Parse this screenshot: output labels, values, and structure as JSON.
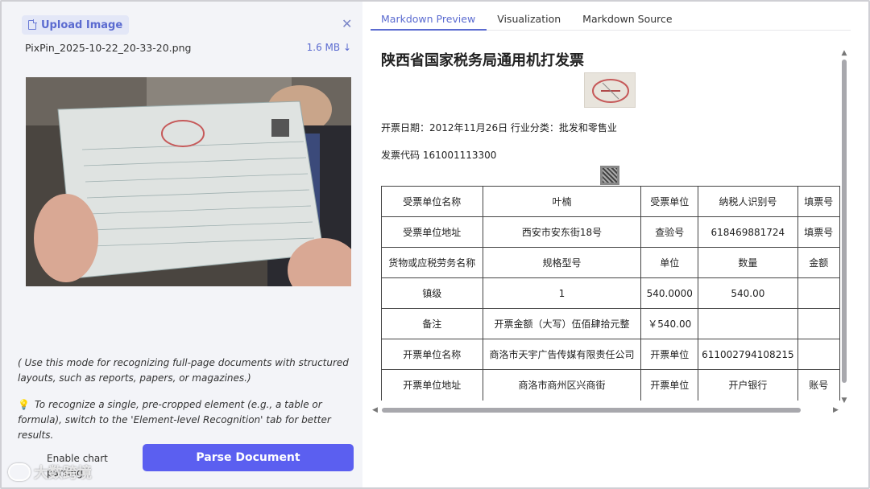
{
  "left": {
    "upload_label": "Upload Image",
    "file_name": "PixPin_2025-10-22_20-33-20.png",
    "file_size": "1.6 MB ↓",
    "hint": "( Use this mode for recognizing full-page documents with structured layouts, such as reports, papers, or magazines.)",
    "tip_icon": "💡",
    "tip": "To recognize a single, pre-cropped element (e.g., a table or formula), switch to the 'Element-level Recognition' tab for better results.",
    "chart_toggle_label": "Enable chart parsing",
    "parse_button": "Parse Document",
    "watermark": "大数跨境"
  },
  "tabs": [
    {
      "label": "Markdown Preview",
      "active": true
    },
    {
      "label": "Visualization",
      "active": false
    },
    {
      "label": "Markdown Source",
      "active": false
    }
  ],
  "preview": {
    "title": "陕西省国家税务局通用机打发票",
    "line1": "开票日期：2012年11月26日 行业分类：批发和零售业",
    "line2": "发票代码 161001113300",
    "table": [
      [
        "受票单位名称",
        "叶楠",
        "受票单位",
        "纳税人识别号",
        "填票号"
      ],
      [
        "受票单位地址",
        "西安市安东街18号",
        "查验号",
        "618469881724",
        "填票号"
      ],
      [
        "货物或应税劳务名称",
        "规格型号",
        "单位",
        "数量",
        "金额"
      ],
      [
        "镇级",
        "1",
        "540.0000",
        "540.00",
        ""
      ],
      [
        "备注",
        "开票金额（大写）伍佰肆拾元整",
        "￥540.00",
        "",
        ""
      ],
      [
        "开票单位名称",
        "商洛市天宇广告传媒有限责任公司",
        "开票单位",
        "611002794108215",
        ""
      ],
      [
        "开票单位地址",
        "商洛市商州区兴商街",
        "开票单位",
        "开户银行",
        "账号"
      ]
    ]
  },
  "colors": {
    "accent": "#5b6bd0",
    "parse_button_bg": "#5b5ff0",
    "left_bg": "#f3f4f8"
  }
}
